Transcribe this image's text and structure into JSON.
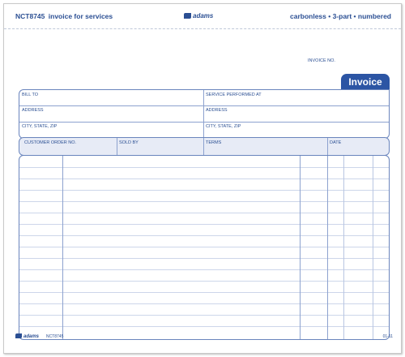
{
  "header": {
    "code": "NCT8745",
    "description": "invoice for services",
    "brand": "adams",
    "spec": "carbonless • 3-part • numbered"
  },
  "invoice_no_label": "INVOICE NO.",
  "invoice_tab": "Invoice",
  "fields": {
    "bill_to": "BILL TO",
    "service_performed_at": "SERVICE PERFORMED AT",
    "address_left": "ADDRESS",
    "address_right": "ADDRESS",
    "city_left": "CITY, STATE, ZIP",
    "city_right": "CITY, STATE, ZIP"
  },
  "order_row": {
    "customer_order_no": "CUSTOMER ORDER NO.",
    "sold_by": "SOLD BY",
    "terms": "TERMS",
    "date": "DATE"
  },
  "footer": {
    "brand": "adams",
    "code": "NCT8745",
    "revision": "01-11"
  },
  "colors": {
    "primary": "#2c55a4",
    "rule": "#8da2cf",
    "shade": "#e7ebf6"
  }
}
